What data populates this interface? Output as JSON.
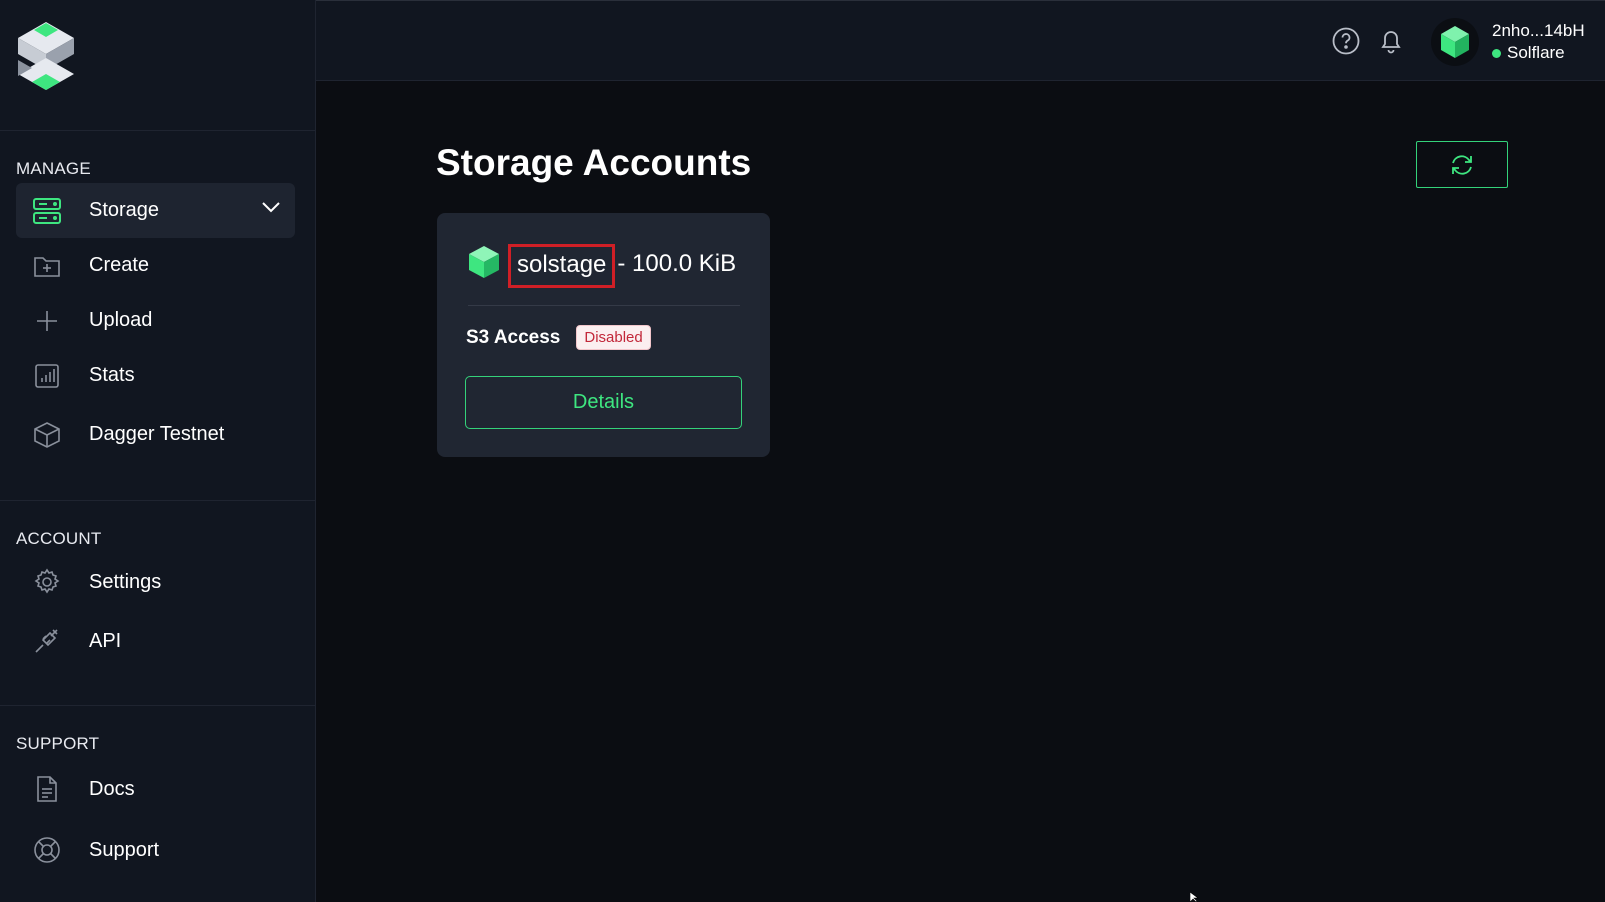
{
  "sidebar": {
    "sections": [
      {
        "label": "MANAGE"
      },
      {
        "label": "ACCOUNT"
      },
      {
        "label": "SUPPORT"
      }
    ],
    "manage": {
      "storage": "Storage",
      "create": "Create",
      "upload": "Upload",
      "stats": "Stats",
      "dagger": "Dagger Testnet"
    },
    "account": {
      "settings": "Settings",
      "api": "API"
    },
    "support": {
      "docs": "Docs",
      "support": "Support"
    }
  },
  "topbar": {
    "wallet_name": "2nho...14bH",
    "wallet_provider": "Solflare",
    "icons": [
      "help-icon",
      "bell-icon",
      "wallet-avatar-icon"
    ]
  },
  "main": {
    "title": "Storage Accounts",
    "refresh_icon": "refresh-icon",
    "accounts": [
      {
        "name": "solstage",
        "size": "- 100.0 KiB",
        "s3_label": "S3 Access",
        "s3_status": "Disabled",
        "details_label": "Details"
      }
    ]
  },
  "colors": {
    "accent": "#3ee680",
    "background": "#0b0d12",
    "sidebar": "#111620",
    "card": "#202632",
    "badge_text": "#c2283a",
    "highlight": "#d01f26"
  }
}
